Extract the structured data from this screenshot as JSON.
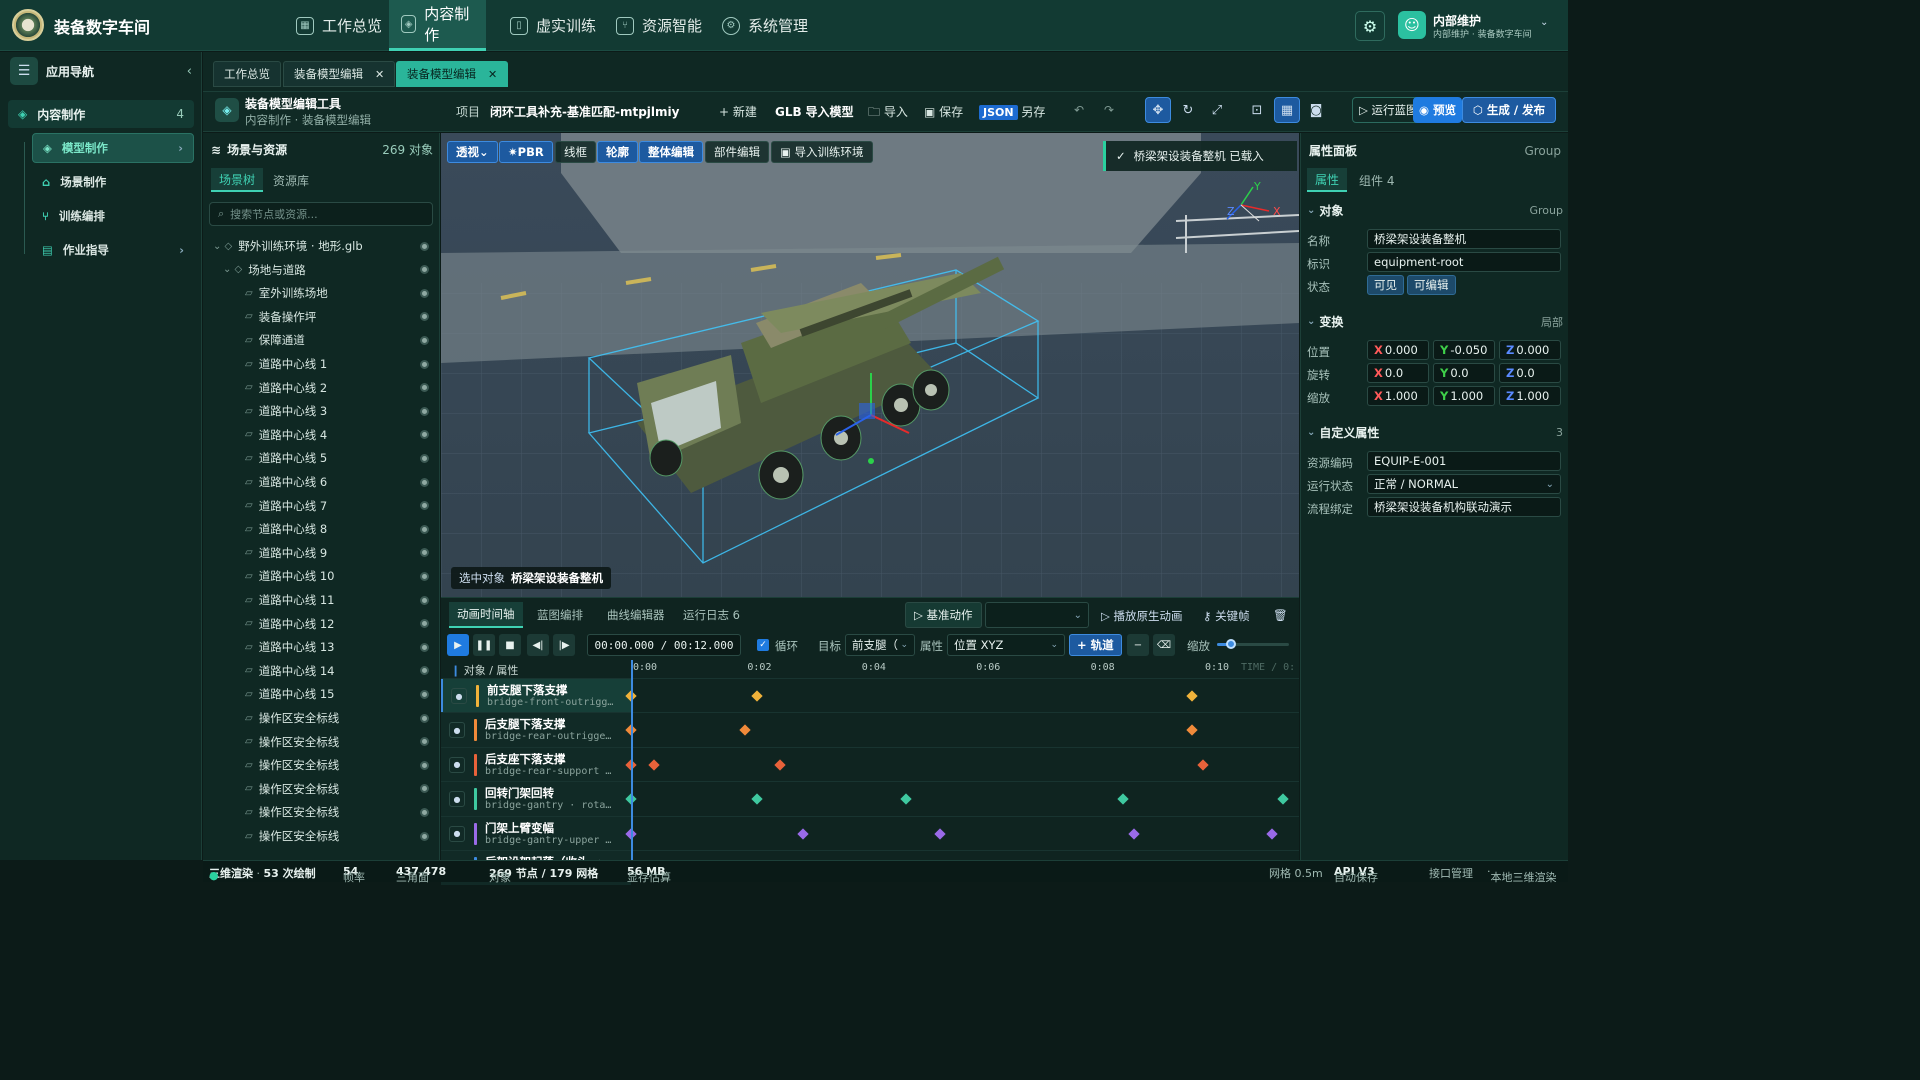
{
  "app": {
    "title": "装备数字车间"
  },
  "topnav": [
    {
      "label": "工作总览",
      "icon": "grid-icon"
    },
    {
      "label": "内容制作",
      "icon": "cube-icon",
      "active": true
    },
    {
      "label": "虚实训练",
      "icon": "book-icon"
    },
    {
      "label": "资源智能",
      "icon": "branch-icon"
    },
    {
      "label": "系统管理",
      "icon": "gear-icon"
    }
  ],
  "user": {
    "name": "内部维护",
    "sub": "内部维护 · 装备数字车间"
  },
  "leftnav": {
    "title": "应用导航",
    "section": {
      "label": "内容制作",
      "count": "4"
    },
    "items": [
      {
        "label": "模型制作",
        "active": true
      },
      {
        "label": "场景制作"
      },
      {
        "label": "训练编排"
      },
      {
        "label": "作业指导"
      }
    ]
  },
  "tabs": [
    {
      "label": "工作总览"
    },
    {
      "label": "装备模型编辑"
    },
    {
      "label": "装备模型编辑",
      "active": true
    }
  ],
  "toolbar": {
    "tool_title": "装备模型编辑工具",
    "breadcrumb": "内容制作 · 装备模型编辑",
    "project_label": "项目",
    "project_name": "闭环工具补充-基准匹配-mtpjlmiy",
    "new": "+ 新建",
    "glb_prefix": "GLB",
    "glb_label": "导入模型",
    "import": "导入",
    "save": "保存",
    "json_badge": "JSON",
    "save_as": "另存",
    "run": "运行蓝图",
    "preview": "预览",
    "publish": "生成 / 发布"
  },
  "scene": {
    "title": "场景与资源",
    "count": "269 对象",
    "tabs": [
      "场景树",
      "资源库"
    ],
    "search_placeholder": "搜索节点或资源...",
    "nodes": [
      {
        "label": "野外训练环境 · 地形.glb",
        "level": 0
      },
      {
        "label": "场地与道路",
        "level": 1
      },
      {
        "label": "室外训练场地",
        "level": 2
      },
      {
        "label": "装备操作坪",
        "level": 2
      },
      {
        "label": "保障通道",
        "level": 2
      },
      {
        "label": "道路中心线 1",
        "level": 2
      },
      {
        "label": "道路中心线 2",
        "level": 2
      },
      {
        "label": "道路中心线 3",
        "level": 2
      },
      {
        "label": "道路中心线 4",
        "level": 2
      },
      {
        "label": "道路中心线 5",
        "level": 2
      },
      {
        "label": "道路中心线 6",
        "level": 2
      },
      {
        "label": "道路中心线 7",
        "level": 2
      },
      {
        "label": "道路中心线 8",
        "level": 2
      },
      {
        "label": "道路中心线 9",
        "level": 2
      },
      {
        "label": "道路中心线 10",
        "level": 2
      },
      {
        "label": "道路中心线 11",
        "level": 2
      },
      {
        "label": "道路中心线 12",
        "level": 2
      },
      {
        "label": "道路中心线 13",
        "level": 2
      },
      {
        "label": "道路中心线 14",
        "level": 2
      },
      {
        "label": "道路中心线 15",
        "level": 2
      },
      {
        "label": "操作区安全标线",
        "level": 2
      },
      {
        "label": "操作区安全标线",
        "level": 2
      },
      {
        "label": "操作区安全标线",
        "level": 2
      },
      {
        "label": "操作区安全标线",
        "level": 2
      },
      {
        "label": "操作区安全标线",
        "level": 2
      },
      {
        "label": "操作区安全标线",
        "level": 2
      }
    ]
  },
  "viewport": {
    "buttons": [
      "透视",
      "PBR",
      "线框",
      "轮廓",
      "整体编辑",
      "部件编辑",
      "导入训练环境"
    ],
    "toast": "桥梁架设装备整机 已载入",
    "selected_prefix": "选中对象",
    "selected_name": "桥梁架设装备整机",
    "gizmo": {
      "x": "X",
      "y": "Y",
      "z": "Z"
    }
  },
  "timeline": {
    "tabs": [
      "动画时间轴",
      "蓝图编排",
      "曲线编辑器",
      "运行日志 6"
    ],
    "base_action": "基准动作",
    "play_native": "播放原生动画",
    "keyframe": "关键帧",
    "timecode": "00:00.000 / 00:12.000",
    "loop_label": "循环",
    "target_label": "目标",
    "target_value": "前支腿（",
    "property_label": "属性",
    "property_value": "位置 XYZ",
    "add_track": "+ 轨道",
    "zoom_label": "缩放",
    "zoom_level": 0.2,
    "header_label": "对象 / 属性",
    "ticks": [
      "0:00",
      "0:02",
      "0:04",
      "0:06",
      "0:08",
      "0:10"
    ],
    "time_label": "TIME / 0:",
    "duration": 12,
    "tracks": [
      {
        "name": "前支腿下落支撑",
        "sub": "bridge-front-outrigg…",
        "color": "#f0b23a",
        "keys": [
          0,
          2.2,
          9.8
        ]
      },
      {
        "name": "后支腿下落支撑",
        "sub": "bridge-rear-outrigge…",
        "color": "#f08a3a",
        "keys": [
          0,
          2.0,
          9.8
        ]
      },
      {
        "name": "后支座下落支撑",
        "sub": "bridge-rear-support …",
        "color": "#e8623a",
        "keys": [
          0,
          0.4,
          2.6,
          10.0
        ]
      },
      {
        "name": "回转门架回转",
        "sub": "bridge-gantry · rota…",
        "color": "#3fc9a0",
        "keys": [
          0,
          2.2,
          4.8,
          8.6,
          11.4
        ]
      },
      {
        "name": "门架上臂变幅",
        "sub": "bridge-gantry-upper …",
        "color": "#9a6ae8",
        "keys": [
          0,
          3.0,
          5.4,
          8.8,
          11.2
        ]
      },
      {
        "name": "后架设架起落（收头 → …",
        "sub": "",
        "color": "#3d8be0",
        "keys": []
      }
    ]
  },
  "props": {
    "title": "属性面板",
    "group": "Group",
    "tabs": [
      "属性",
      "组件 4"
    ],
    "object_section": "对象",
    "object_right": "Group",
    "name_label": "名称",
    "name_value": "桥梁架设装备整机",
    "id_label": "标识",
    "id_value": "equipment-root",
    "state_label": "状态",
    "visible": "可见",
    "editable": "可编辑",
    "transform_section": "变换",
    "transform_right": "局部",
    "position_label": "位置",
    "position": [
      "0.000",
      "-0.050",
      "0.000"
    ],
    "rotation_label": "旋转",
    "rotation": [
      "0.0",
      "0.0",
      "0.0"
    ],
    "scale_label": "缩放",
    "scale": [
      "1.000",
      "1.000",
      "1.000"
    ],
    "custom_section": "自定义属性",
    "custom_count": "3",
    "asset_label": "资源编码",
    "asset_value": "EQUIP-E-001",
    "run_label": "运行状态",
    "run_value": "正常 / NORMAL",
    "flow_label": "流程绑定",
    "flow_value": "桥梁架设装备机构联动演示"
  },
  "status": {
    "render": "三维渲染",
    "draws": "53 次绘制",
    "fps_label": "帧率",
    "fps": "54",
    "tri_label": "三角面",
    "tri": "437,478",
    "obj_label": "对象",
    "obj": "269 节点 / 179 网格",
    "mem_label": "显存估算",
    "mem": "56 MB",
    "grid": "网格 0.5m",
    "autosave": "自动保存",
    "api": "API V3",
    "iface": "接口管理",
    "local": "本地三维渲染"
  },
  "colors": {
    "accent": "#3fd1b3",
    "primary": "#1f7be0",
    "bg": "#0f2823"
  }
}
